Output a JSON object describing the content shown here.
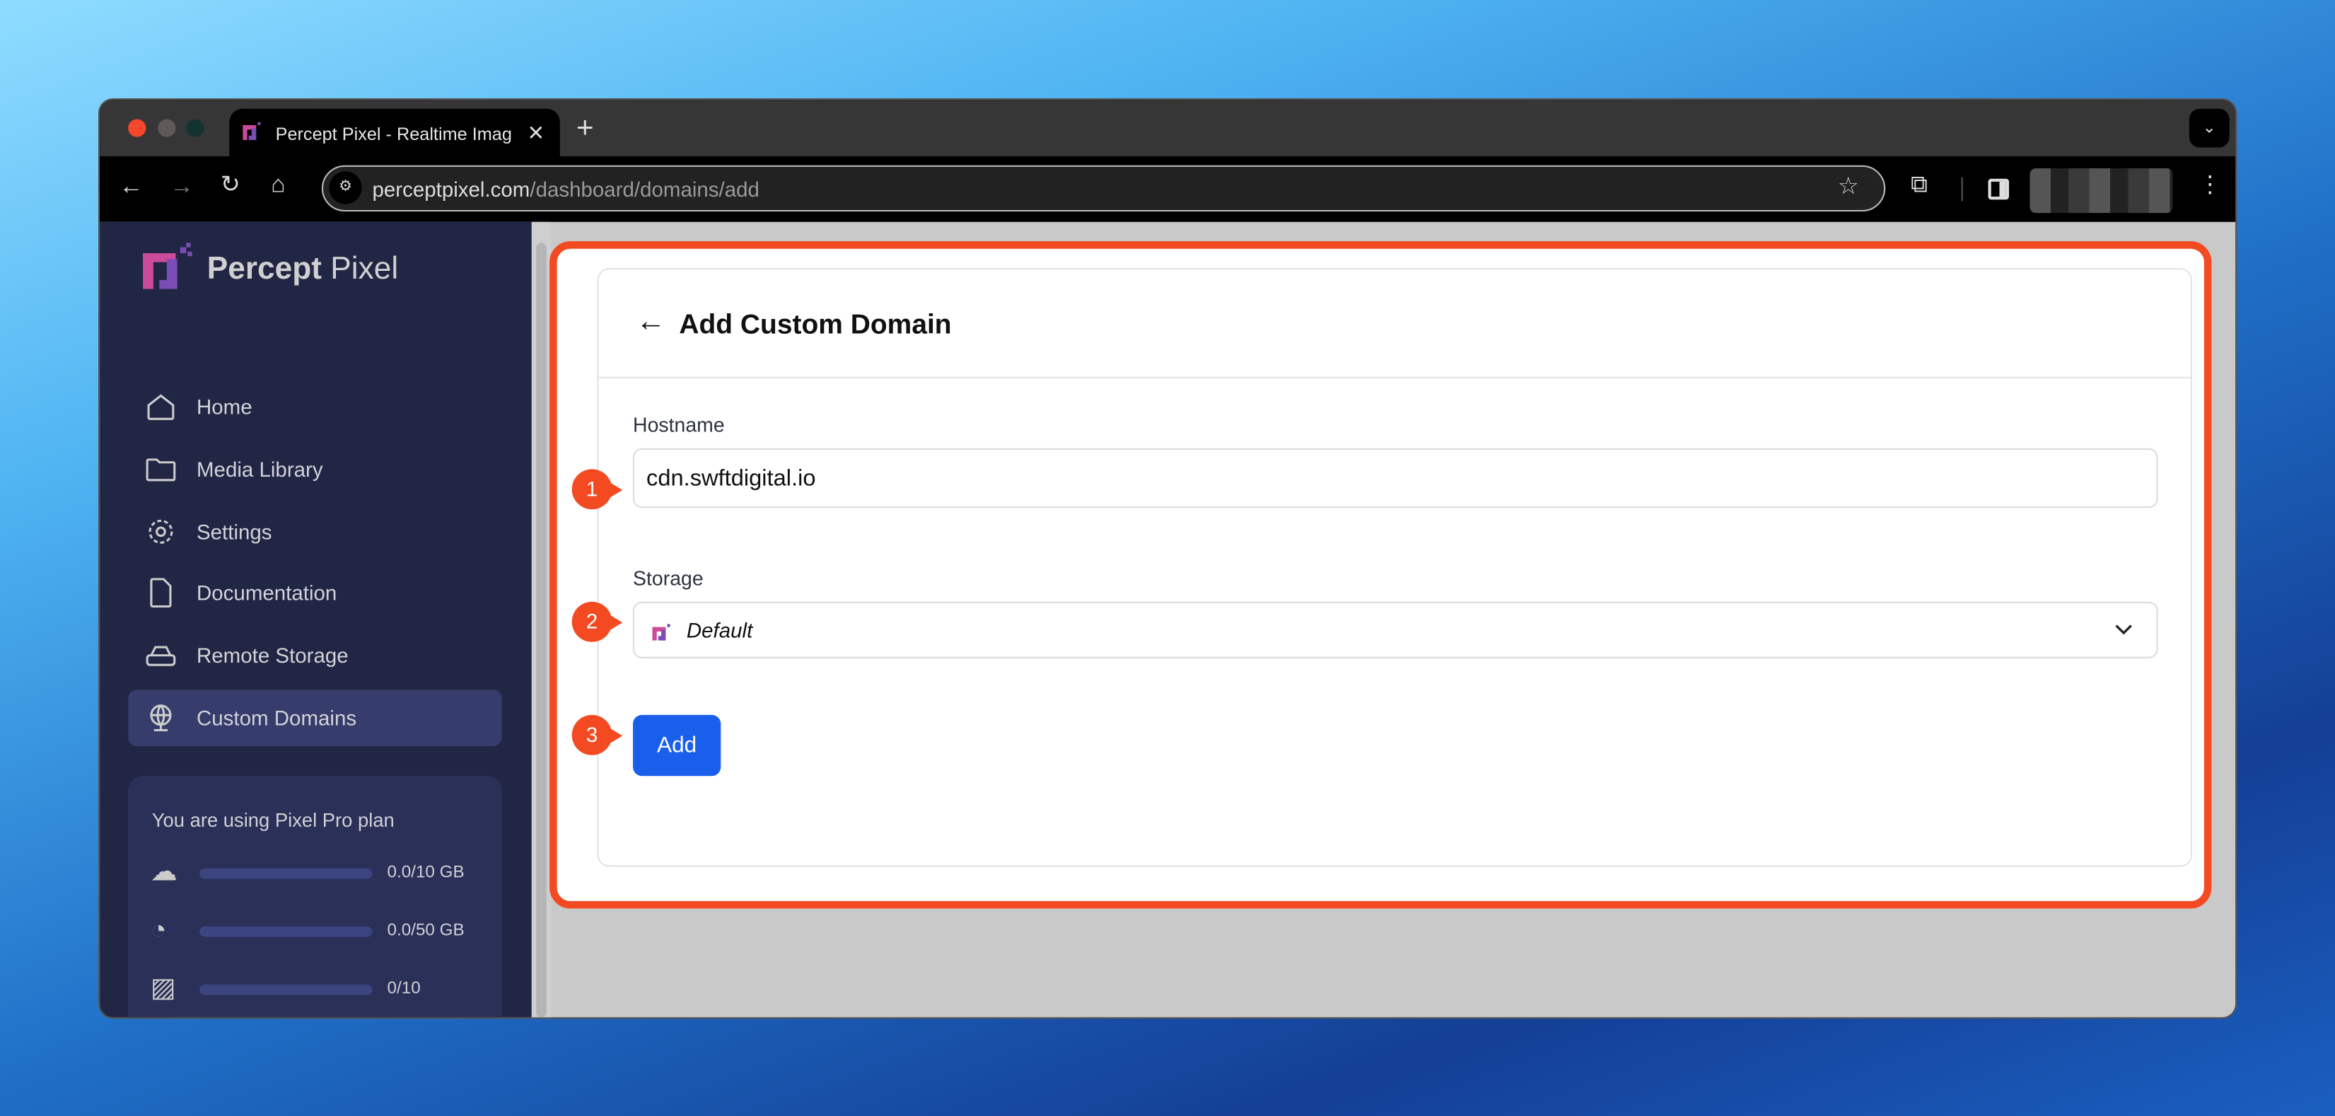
{
  "browser": {
    "tab_title": "Percept Pixel - Realtime Imag",
    "url_domain": "perceptpixel.com",
    "url_path": "/dashboard/domains/add"
  },
  "sidebar": {
    "brand_bold": "Percept",
    "brand_light": "Pixel",
    "items": [
      {
        "label": "Home",
        "icon": "home-icon"
      },
      {
        "label": "Media Library",
        "icon": "folder-icon"
      },
      {
        "label": "Settings",
        "icon": "gear-icon"
      },
      {
        "label": "Documentation",
        "icon": "file-icon"
      },
      {
        "label": "Remote Storage",
        "icon": "hard-drive-icon"
      },
      {
        "label": "Custom Domains",
        "icon": "globe-icon",
        "active": true
      }
    ],
    "plan": {
      "title": "You are using Pixel Pro plan",
      "usage": [
        {
          "icon": "cloud-upload-icon",
          "value": "0.0/10 GB",
          "fraction": 0
        },
        {
          "icon": "gauge-icon",
          "value": "0.0/50 GB",
          "fraction": 0
        },
        {
          "icon": "image-check-icon",
          "value": "0/10",
          "fraction": 0
        }
      ]
    }
  },
  "page": {
    "title": "Add Custom Domain",
    "hostname_label": "Hostname",
    "hostname_value": "cdn.swftdigital.io",
    "storage_label": "Storage",
    "storage_value": "Default",
    "add_label": "Add"
  },
  "markers": [
    "1",
    "2",
    "3"
  ],
  "colors": {
    "accent": "#1a5fec",
    "highlight": "#f44a22",
    "sidebar": "#222645"
  }
}
